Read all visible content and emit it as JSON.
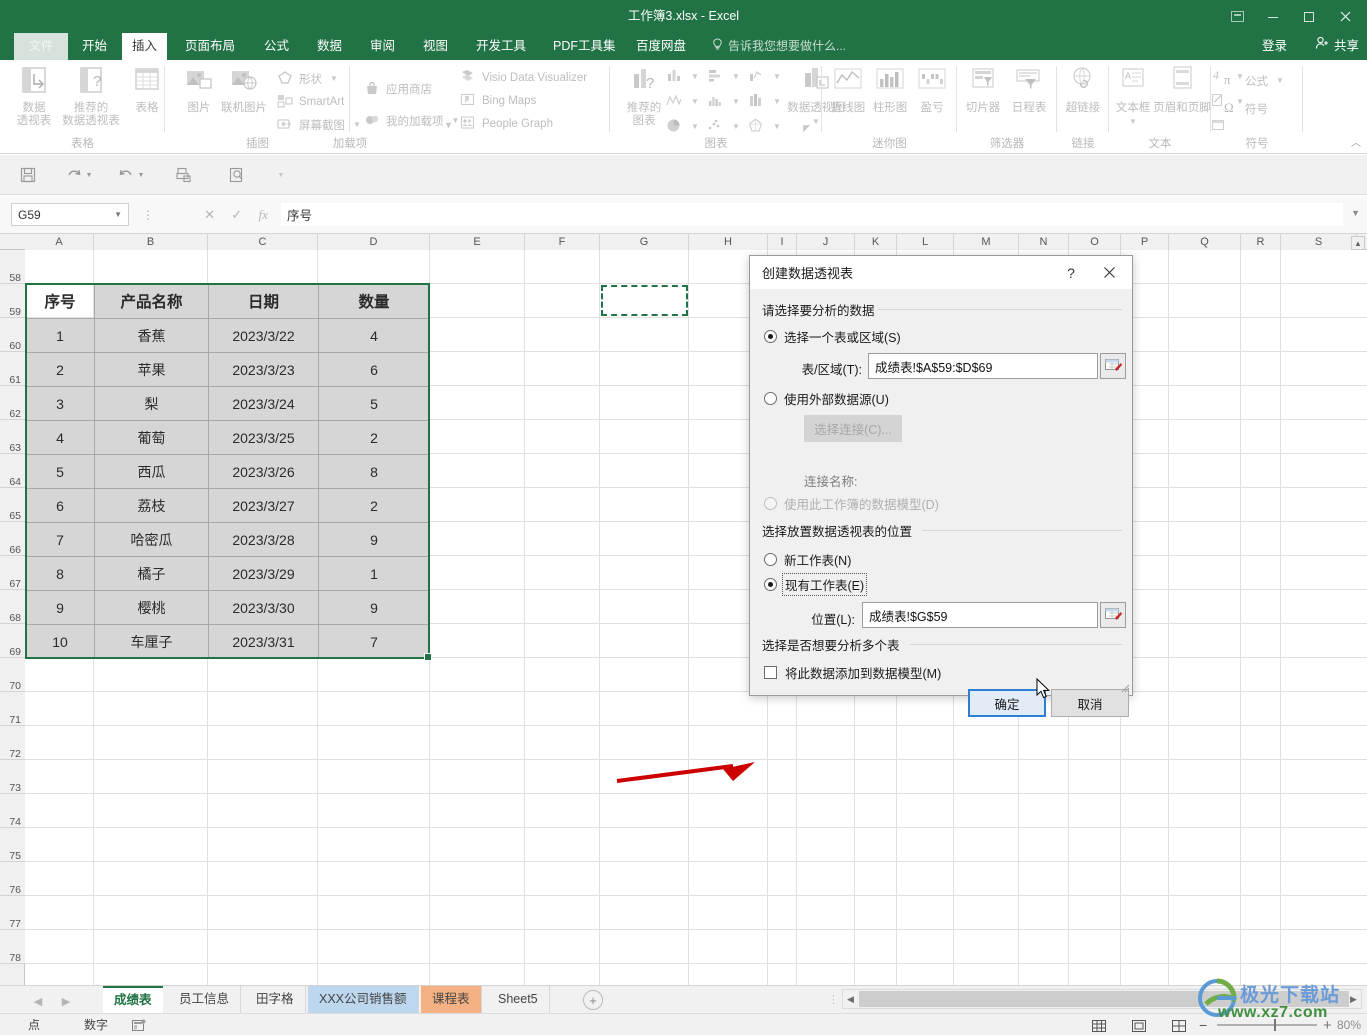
{
  "window": {
    "title": "工作簿3.xlsx - Excel",
    "minimize": "−",
    "maximize": "□",
    "close": "✕",
    "ribbon_display": "ribbon-display-options"
  },
  "tabs": [
    {
      "label": "文件",
      "state": "file"
    },
    {
      "label": "开始",
      "state": "normal"
    },
    {
      "label": "插入",
      "state": "active"
    },
    {
      "label": "页面布局",
      "state": "normal"
    },
    {
      "label": "公式",
      "state": "normal"
    },
    {
      "label": "数据",
      "state": "normal"
    },
    {
      "label": "审阅",
      "state": "normal"
    },
    {
      "label": "视图",
      "state": "normal"
    },
    {
      "label": "开发工具",
      "state": "normal"
    },
    {
      "label": "PDF工具集",
      "state": "normal"
    },
    {
      "label": "百度网盘",
      "state": "normal"
    }
  ],
  "tellme": "告诉我您想要做什么...",
  "signin": "登录",
  "share": "共享",
  "ribbon": {
    "groups": [
      {
        "name": "表格",
        "label": "表格"
      },
      {
        "name": "插图",
        "label": "插图"
      },
      {
        "name": "加载项",
        "label": "加载项"
      },
      {
        "name": "图表",
        "label": "图表"
      },
      {
        "name": "迷你图",
        "label": "迷你图"
      },
      {
        "name": "筛选器",
        "label": "筛选器"
      },
      {
        "name": "链接",
        "label": "链接"
      },
      {
        "name": "文本",
        "label": "文本"
      },
      {
        "name": "符号",
        "label": "符号"
      }
    ],
    "tables": {
      "pivottable": "数据\n透视表",
      "pivottable_l1": "数据",
      "pivottable_l2": "透视表",
      "recommended_l1": "推荐的",
      "recommended_l2": "数据透视表",
      "table": "表格"
    },
    "illustrations": {
      "picture": "图片",
      "online_picture": "联机图片",
      "shapes": "形状",
      "smartart": "SmartArt",
      "screenshot": "屏幕截图"
    },
    "addins": {
      "store": "应用商店",
      "myaddins": "我的加载项",
      "visio": "Visio Data Visualizer",
      "bing": "Bing Maps",
      "people": "People Graph"
    },
    "charts": {
      "recommended_l1": "推荐的",
      "recommended_l2": "图表",
      "pivotchart": "数据透视图"
    },
    "sparklines": {
      "line": "折线图",
      "column": "柱形图",
      "winloss": "盈亏"
    },
    "filters": {
      "slicer": "切片器",
      "timeline": "日程表"
    },
    "links": {
      "hyperlink": "超链接"
    },
    "text": {
      "textbox": "文本框",
      "header_footer": "页眉和页脚"
    },
    "symbols": {
      "equation": "公式",
      "symbol": "符号"
    }
  },
  "formula_bar": {
    "name_box": "G59",
    "value": "序号",
    "cancel": "✕",
    "enter": "✓",
    "fx": "fx"
  },
  "grid": {
    "columns": [
      "A",
      "B",
      "C",
      "D",
      "E",
      "F",
      "G",
      "H",
      "I",
      "J",
      "K",
      "L",
      "M",
      "N",
      "O",
      "P",
      "Q",
      "R",
      "S"
    ],
    "rows": [
      "58",
      "59",
      "60",
      "61",
      "62",
      "63",
      "64",
      "65",
      "66",
      "67",
      "68",
      "69",
      "70",
      "71",
      "72",
      "73",
      "74",
      "75",
      "76",
      "77",
      "78"
    ],
    "table_headers": [
      "序号",
      "产品名称",
      "日期",
      "数量"
    ],
    "table_rows": [
      [
        "1",
        "香蕉",
        "2023/3/22",
        "4"
      ],
      [
        "2",
        "苹果",
        "2023/3/23",
        "6"
      ],
      [
        "3",
        "梨",
        "2023/3/24",
        "5"
      ],
      [
        "4",
        "葡萄",
        "2023/3/25",
        "2"
      ],
      [
        "5",
        "西瓜",
        "2023/3/26",
        "8"
      ],
      [
        "6",
        "荔枝",
        "2023/3/27",
        "2"
      ],
      [
        "7",
        "哈密瓜",
        "2023/3/28",
        "9"
      ],
      [
        "8",
        "橘子",
        "2023/3/29",
        "1"
      ],
      [
        "9",
        "樱桃",
        "2023/3/30",
        "9"
      ],
      [
        "10",
        "车厘子",
        "2023/3/31",
        "7"
      ]
    ]
  },
  "dialog": {
    "title": "创建数据透视表",
    "help": "?",
    "close": "✕",
    "section1_label": "请选择要分析的数据",
    "radio_table_range": "选择一个表或区域(S)",
    "label_table_range": "表/区域(T):",
    "value_table_range": "成绩表!$A$59:$D$69",
    "radio_external": "使用外部数据源(U)",
    "btn_choose_connection": "选择连接(C)...",
    "label_connection_name": "连接名称:",
    "radio_data_model": "使用此工作簿的数据模型(D)",
    "section2_label": "选择放置数据透视表的位置",
    "radio_new_sheet": "新工作表(N)",
    "radio_existing_sheet": "现有工作表(E)",
    "label_location": "位置(L):",
    "value_location": "成绩表!$G$59",
    "section3_label": "选择是否想要分析多个表",
    "checkbox_add_to_model": "将此数据添加到数据模型(M)",
    "btn_ok": "确定",
    "btn_cancel": "取消"
  },
  "sheet_tabs": [
    {
      "label": "成绩表",
      "state": "active",
      "color": ""
    },
    {
      "label": "员工信息",
      "state": "normal",
      "color": ""
    },
    {
      "label": "田字格",
      "state": "normal",
      "color": ""
    },
    {
      "label": "XXX公司销售额",
      "state": "normal",
      "color": "#bdd7ee"
    },
    {
      "label": "课程表",
      "state": "normal",
      "color": "#f4b183"
    },
    {
      "label": "Sheet5",
      "state": "normal",
      "color": ""
    }
  ],
  "add_sheet": "+",
  "status_bar": {
    "mode": "点",
    "numeric": "数字",
    "macro_icon": "record-macro-icon",
    "view_normal": "normal-view-icon",
    "view_layout": "page-layout-icon",
    "view_pagebreak": "page-break-icon",
    "zoom_out": "−",
    "zoom_in": "+",
    "zoom_level": "80%"
  },
  "watermark": {
    "line1": "极光下载站",
    "line2": "www.xz7.com"
  },
  "colors": {
    "excel_green": "#217346",
    "selection_gray": "#d6d6d6",
    "primary_button": "#2f7fd0",
    "arrow_red": "#cc0000"
  }
}
